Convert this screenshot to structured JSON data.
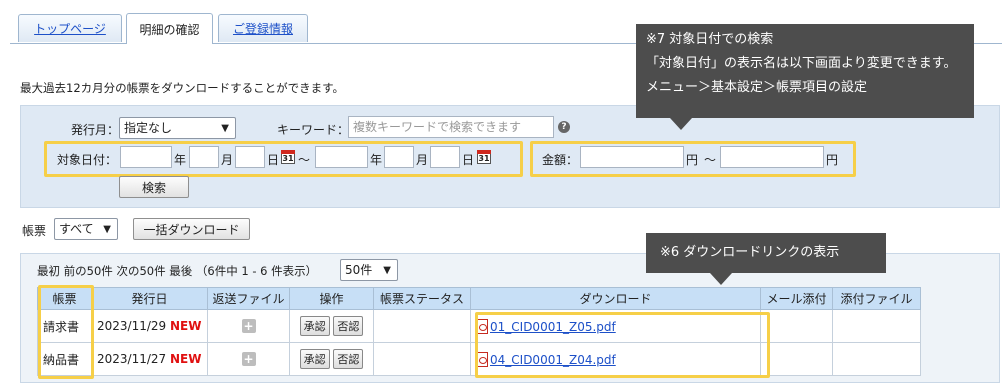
{
  "tabs": {
    "top": "トップページ",
    "detail": "明細の確認",
    "registration": "ご登録情報"
  },
  "description": "最大過去12カ月分の帳票をダウンロードすることができます。",
  "search": {
    "issue_month_label": "発行月：",
    "issue_month_value": "指定なし",
    "keyword_label": "キーワード：",
    "keyword_placeholder": "複数キーワードで検索できます",
    "target_date_label": "対象日付：",
    "year": "年",
    "month": "月",
    "day": "日",
    "tilde": "〜",
    "calendar_day": "31",
    "amount_label": "金額：",
    "yen": "円",
    "submit": "検索"
  },
  "form_filter": {
    "label": "帳票",
    "value": "すべて",
    "bulk_download": "一括ダウンロード"
  },
  "pagination": {
    "text": "最初 前の50件 次の50件 最後 （6件中 1 - 6 件表示）",
    "page_size": "50件"
  },
  "table": {
    "headers": [
      "帳票",
      "発行日",
      "返送ファイル",
      "操作",
      "帳票ステータス",
      "ダウンロード",
      "メール添付",
      "添付ファイル"
    ],
    "approve": "承認",
    "reject": "否認",
    "new_label": "NEW",
    "rows": [
      {
        "form": "請求書",
        "date": "2023/11/29",
        "file": "01_CID0001_Z05.pdf"
      },
      {
        "form": "納品書",
        "date": "2023/11/27",
        "file": "04_CID0001_Z04.pdf"
      }
    ]
  },
  "callouts": {
    "c7_line1": "※7  対象日付での検索",
    "c7_line2": "「対象日付」の表示名は以下画面より変更できます。",
    "c7_line3": "メニュー＞基本設定＞帳票項目の設定",
    "c6": "※6  ダウンロードリンクの表示"
  },
  "colors": {
    "highlight": "#f6cf48",
    "callout_bg": "#4d4d4d",
    "panel_bg": "#dfe9f4",
    "header_bg": "#c7dff6",
    "new_color": "#e01010",
    "link_color": "#1d50c8"
  }
}
